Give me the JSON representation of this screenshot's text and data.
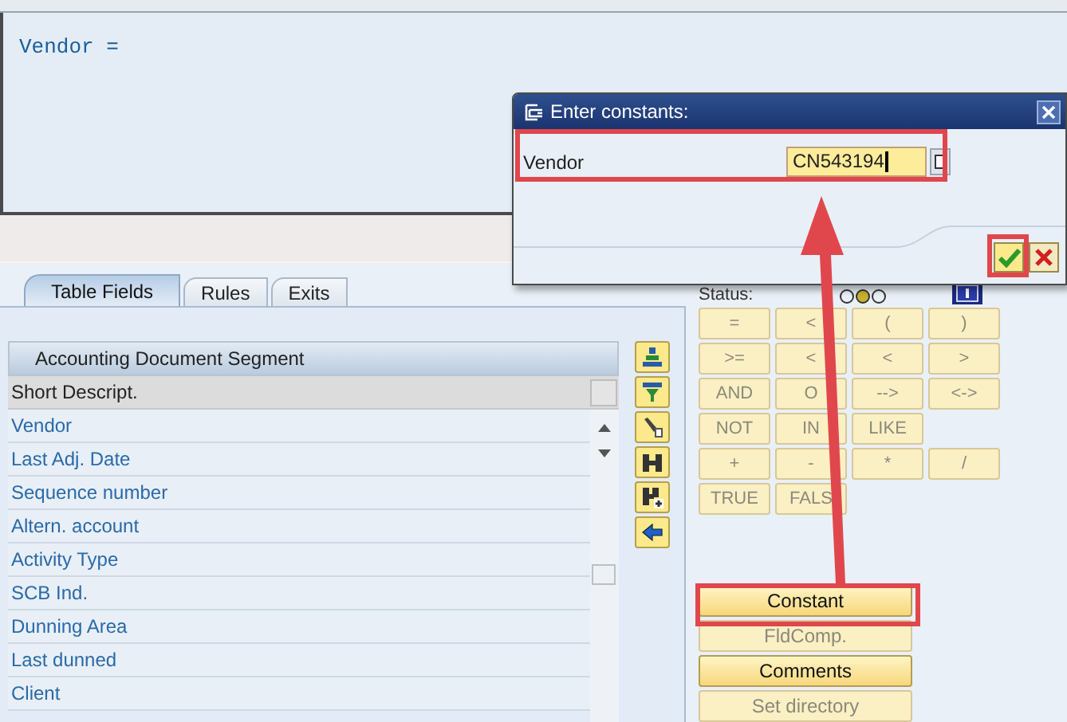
{
  "editor": {
    "text": "Vendor ="
  },
  "tabs": [
    {
      "label": "Table Fields",
      "selected": true
    },
    {
      "label": "Rules",
      "selected": false
    },
    {
      "label": "Exits",
      "selected": false
    }
  ],
  "table": {
    "title": "Accounting Document Segment",
    "columns": [
      "Short Descript."
    ],
    "rows": [
      "Vendor",
      "Last Adj. Date",
      "Sequence number",
      "Altern. account",
      "Activity Type",
      "SCB Ind.",
      "Dunning Area",
      "Last dunned",
      "Client"
    ]
  },
  "status": {
    "label": "Status:"
  },
  "operator_rows": [
    {
      "buttons": [
        {
          "label": "=",
          "disabled": true
        },
        {
          "label": "<",
          "disabled": true
        },
        {
          "label": "(",
          "disabled": true
        },
        {
          "label": ")",
          "disabled": true
        }
      ]
    },
    {
      "buttons": [
        {
          "label": ">=",
          "disabled": true
        },
        {
          "label": "<",
          "disabled": true
        },
        {
          "label": "<",
          "disabled": true
        },
        {
          "label": ">",
          "disabled": true
        }
      ]
    },
    {
      "buttons": [
        {
          "label": "AND",
          "disabled": true
        },
        {
          "label": "O",
          "disabled": true
        },
        {
          "label": "-->",
          "disabled": true
        },
        {
          "label": "<->",
          "disabled": true
        }
      ]
    },
    {
      "buttons": [
        {
          "label": "NOT",
          "disabled": true
        },
        {
          "label": "IN",
          "disabled": true
        },
        {
          "label": "LIKE",
          "disabled": true
        }
      ]
    },
    {
      "buttons": [
        {
          "label": "+",
          "disabled": true
        },
        {
          "label": "-",
          "disabled": true
        },
        {
          "label": "*",
          "disabled": true
        },
        {
          "label": "/",
          "disabled": true
        }
      ]
    },
    {
      "buttons": [
        {
          "label": "TRUE",
          "disabled": true
        },
        {
          "label": "FALS",
          "disabled": true
        }
      ]
    }
  ],
  "actions": [
    {
      "label": "Constant",
      "disabled": false
    },
    {
      "label": "FldComp.",
      "disabled": true
    },
    {
      "label": "Comments",
      "disabled": false
    },
    {
      "label": "Set directory",
      "disabled": true
    }
  ],
  "dialog": {
    "title": "Enter constants:",
    "field_label": "Vendor",
    "value": "CN543194"
  }
}
